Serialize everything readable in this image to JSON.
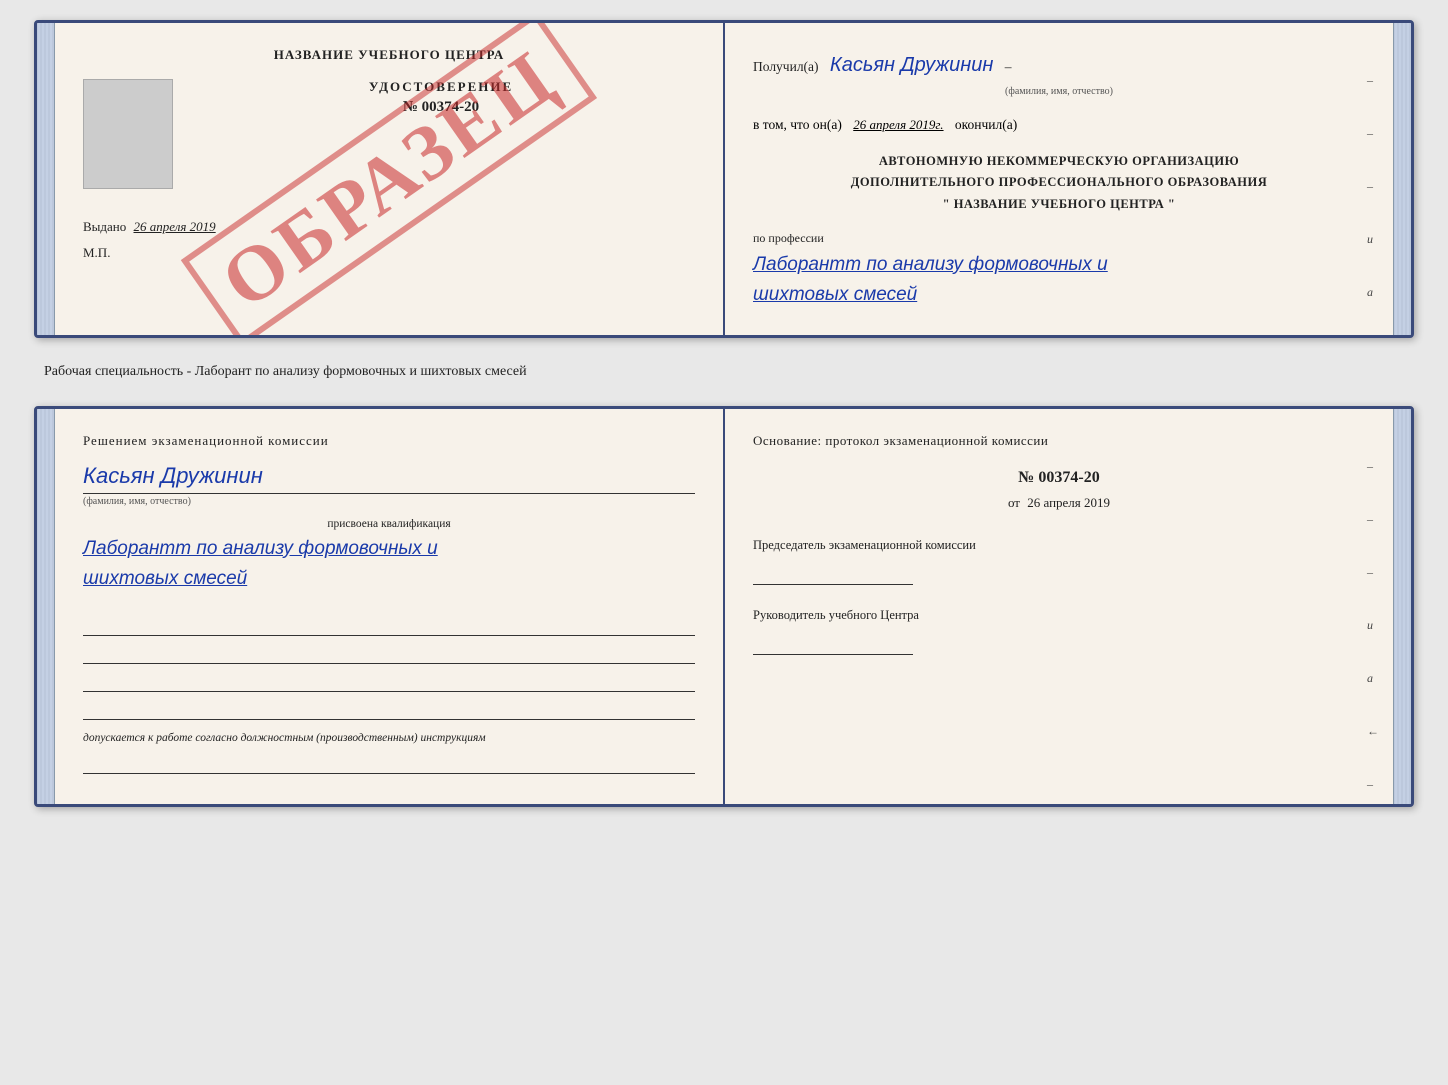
{
  "doc1": {
    "left": {
      "title": "НАЗВАНИЕ УЧЕБНОГО ЦЕНТРА",
      "watermark": "ОБРАЗЕЦ",
      "cert_label": "УДОСТОВЕРЕНИЕ",
      "cert_number": "№ 00374-20",
      "issued_label": "Выдано",
      "issued_date": "26 апреля 2019",
      "mp_label": "М.П."
    },
    "right": {
      "received_prefix": "Получил(а)",
      "received_name": "Касьян Дружинин",
      "received_sub": "(фамилия, имя, отчество)",
      "date_prefix": "в том, что он(а)",
      "date_value": "26 апреля 2019г.",
      "date_suffix": "окончил(а)",
      "org_line1": "АВТОНОМНУЮ НЕКОММЕРЧЕСКУЮ ОРГАНИЗАЦИЮ",
      "org_line2": "ДОПОЛНИТЕЛЬНОГО ПРОФЕССИОНАЛЬНОГО ОБРАЗОВАНИЯ",
      "org_line3": "\"  НАЗВАНИЕ УЧЕБНОГО ЦЕНТРА  \"",
      "profession_prefix": "по профессии",
      "profession_value": "Лаборантт по анализу формовочных и шихтовых смесей",
      "side_chars": [
        "–",
        "–",
        "–",
        "и",
        "а",
        "←",
        "–",
        "–",
        "–"
      ]
    }
  },
  "separator": {
    "text": "Рабочая специальность - Лаборант по анализу формовочных и шихтовых смесей"
  },
  "doc2": {
    "left": {
      "decision_text": "Решением  экзаменационной  комиссии",
      "name": "Касьян Дружинин",
      "name_sub": "(фамилия, имя, отчество)",
      "qualification_label": "присвоена квалификация",
      "qualification_value": "Лаборантт по анализу формовочных и шихтовых смесей",
      "допускается_text": "допускается к  работе согласно должностным (производственным) инструкциям"
    },
    "right": {
      "osnov_text": "Основание: протокол экзаменационной  комиссии",
      "protocol_number": "№  00374-20",
      "protocol_date_prefix": "от",
      "protocol_date": "26 апреля 2019",
      "chairman_label": "Председатель экзаменационной комиссии",
      "head_label": "Руководитель учебного Центра",
      "side_chars": [
        "–",
        "–",
        "–",
        "и",
        "а",
        "←",
        "–",
        "–",
        "–"
      ]
    }
  }
}
